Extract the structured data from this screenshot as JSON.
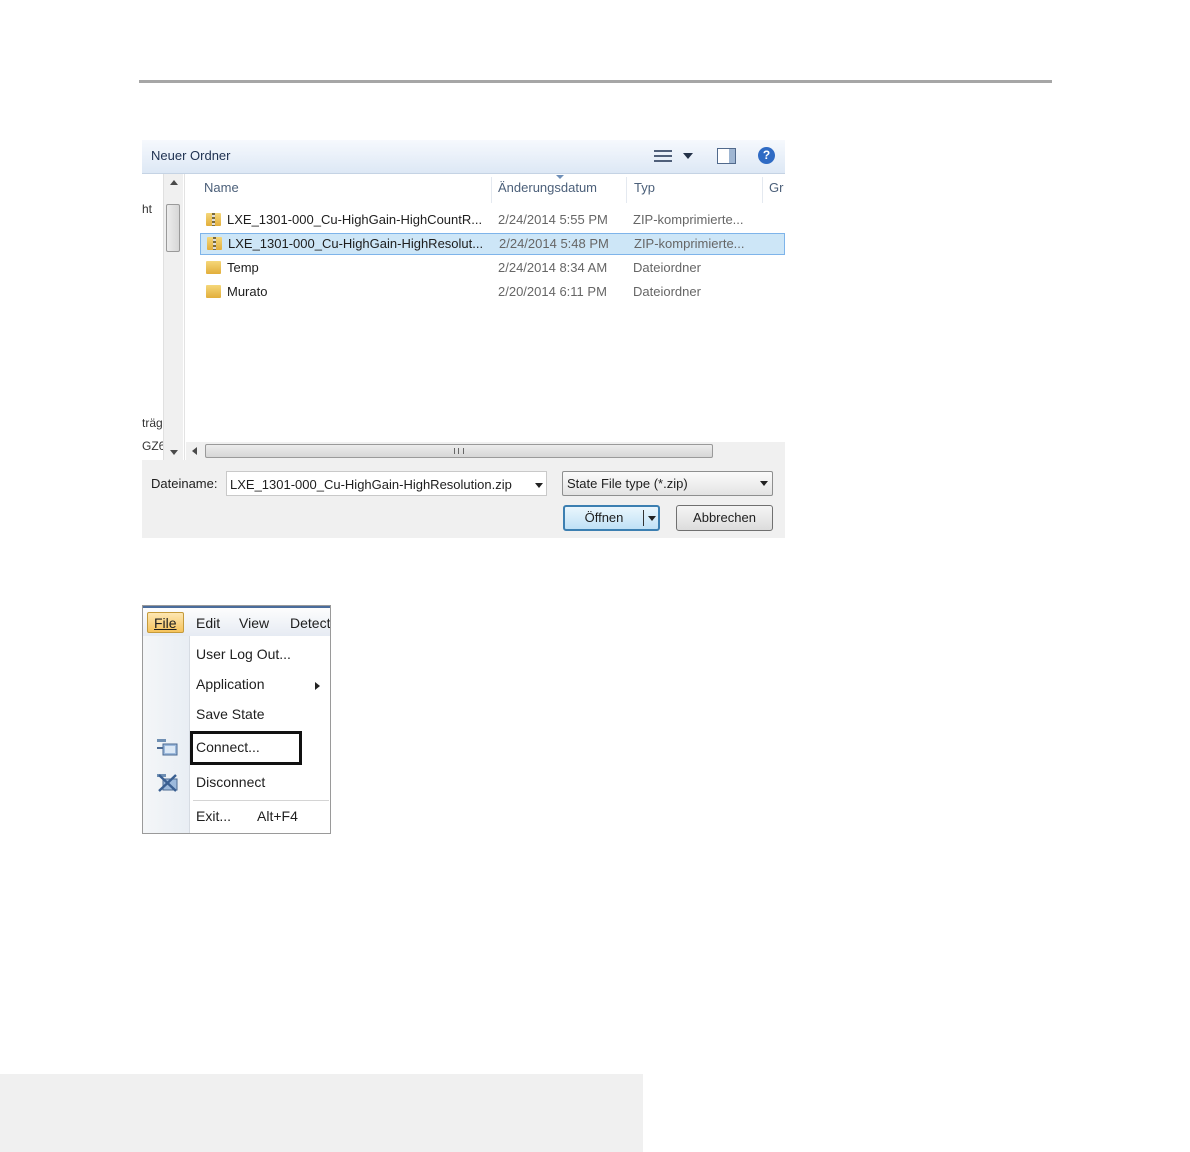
{
  "dialog": {
    "toolbar": {
      "new_folder": "Neuer Ordner",
      "help": "?"
    },
    "nav_fragments": [
      "ht",
      "träg",
      "GZ6"
    ],
    "columns": {
      "name": "Name",
      "date": "Änderungsdatum",
      "type": "Typ",
      "size": "Gr"
    },
    "files": [
      {
        "name": "LXE_1301-000_Cu-HighGain-HighCountR...",
        "date": "2/24/2014 5:55 PM",
        "type": "ZIP-komprimierte...",
        "icon": "zip-folder-icon",
        "selected": false
      },
      {
        "name": "LXE_1301-000_Cu-HighGain-HighResolut...",
        "date": "2/24/2014 5:48 PM",
        "type": "ZIP-komprimierte...",
        "icon": "zip-folder-icon",
        "selected": true
      },
      {
        "name": "Temp",
        "date": "2/24/2014 8:34 AM",
        "type": "Dateiordner",
        "icon": "folder-icon",
        "selected": false
      },
      {
        "name": "Murato",
        "date": "2/20/2014 6:11 PM",
        "type": "Dateiordner",
        "icon": "folder-icon",
        "selected": false
      }
    ],
    "filename_label": "Dateiname:",
    "filename_value": "LXE_1301-000_Cu-HighGain-HighResolution.zip",
    "filetype_value": "State File type (*.zip)",
    "open_label": "Öffnen",
    "cancel_label": "Abbrechen",
    "colors": {
      "selection": "#cde6f7",
      "selection_border": "#7eb4ea"
    }
  },
  "menu": {
    "menubar": [
      "File",
      "Edit",
      "View",
      "Detect"
    ],
    "items": [
      {
        "label": "User Log Out...",
        "icon": null
      },
      {
        "label": "Application",
        "icon": null,
        "submenu": true
      },
      {
        "label": "Save State",
        "icon": null
      },
      {
        "label": "Connect...",
        "icon": "connect-icon",
        "highlighted": true
      },
      {
        "label": "Disconnect",
        "icon": "disconnect-icon"
      },
      {
        "label": "Exit...",
        "accel": "Alt+F4",
        "icon": null
      }
    ]
  }
}
